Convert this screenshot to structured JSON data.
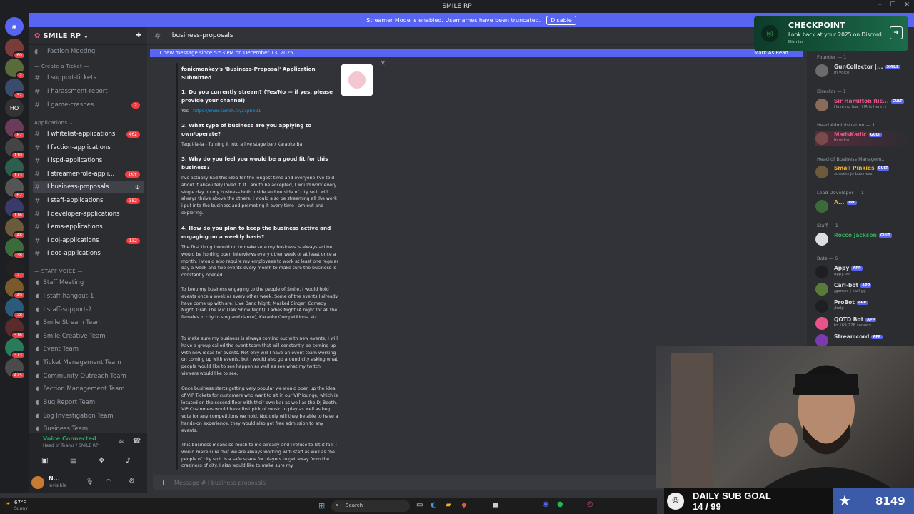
{
  "window": {
    "title": "SMILE RP"
  },
  "streamer_banner": {
    "text": "Streamer Mode is enabled. Usernames have been truncated.",
    "button": "Disable"
  },
  "server": {
    "name": "SMILE RP"
  },
  "guild_badges": [
    "60",
    "2",
    "32",
    "82",
    "110",
    "173",
    "62",
    "116",
    "48",
    "38",
    "27",
    "49",
    "28",
    "316",
    "373",
    "425"
  ],
  "channels": {
    "faction_meeting": "Faction Meeting",
    "create_ticket_cat": "Create a Ticket",
    "support_tickets": "I support-tickets",
    "harassment_report": "I harassment-report",
    "game_crashes": "I game-crashes",
    "game_crashes_count": "2",
    "applications_cat": "Applications",
    "whitelist_applications": "I whitelist-applications",
    "whitelist_count": "462",
    "faction_applications": "I faction-applications",
    "lspd_applications": "I lspd-applications",
    "streamer_role": "I streamer-role-appli...",
    "streamer_count": "1K+",
    "business_proposals": "I business-proposals",
    "staff_applications": "I staff-applications",
    "staff_count": "382",
    "developer_applications": "I developer-applications",
    "ems_applications": "I ems-applications",
    "doj_applications": "I doj-applications",
    "doj_count": "132",
    "doc_applications": "I doc-applications",
    "staff_voice_cat": "STAFF VOICE",
    "voice": [
      "Staff Meeting",
      "I staff-hangout-1",
      "I staff-support-2",
      "Smile Stream Team",
      "Smile Creative Team",
      "Event Team",
      "Ticket Management Team",
      "Community Outreach Team",
      "Faction Management Team",
      "Bug Report Team",
      "Log Investigation Team",
      "Business Team"
    ]
  },
  "voicebar": {
    "status": "Voice Connected",
    "location": "Head of Teams / SMILE RP"
  },
  "user": {
    "name": "N...",
    "status": "Invisible"
  },
  "header": {
    "channel": "I business-proposals"
  },
  "new_message": {
    "text": "1 new message since 5:53 PM on December 13, 2025",
    "mark": "Mark As Read"
  },
  "message": {
    "title": "fonicmonkey's 'Business-Proposal' Application Submitted",
    "q1": "1. Do you currently stream? (Yes/No — if yes, please provide your channel)",
    "a1_prefix": "Yes - ",
    "a1_link": "https://www.twitch.tv/21phe21",
    "q2": "2. What type of business are you applying to own/operate?",
    "a2": "Tequi-la-la - Turning it into a live stage bar/ Karaoke Bar",
    "q3": "3. Why do you feel you would be a good fit for this business?",
    "a3": "I've actually had this idea for the longest time and everyone I've told about it absolutely loved it. If I am to be accepted, I would work every single day on my business both inside and outside of city so it will always thrive above the others. I would also be streaming all the work i put into the business and promoting it every time i am out and exploring.",
    "q4": "4. How do you plan to keep the business active and engaging on a weekly basis?",
    "a4_p1": "The first thing I would do to make sure my business is always active would be holding open interviews every other week or at least once a month. I would also require my employees to work at least one regular day a week and two events every month to make sure the business is constantly opened.",
    "a4_p2": "To keep my business engaging to the people of Smile, I would hold events once a week or every other week. Some of the events I already have come up with are: Live Band Night, Masked Singer, Comedy Night, Grab The Mic (Talk Show Night), Ladies Night (A night for all the females in city to sing and dance), Karaoke Competitions, etc.",
    "a4_p3": "To make sure my business is always coming out with new events, I will have a group called the event team that will constantly be coming up with new ideas for events. Not only will I have an event team working on coming up with events, but i would also go around city asking what people would like to see happen as well as see what my twitch viewers would like to see.",
    "a4_p4": "Once business starts getting very popular we would open up the idea of VIP Tickets for customers who want to sit in our VIP lounge, which is located on the second floor with their own bar as well as the DJ Booth. VIP Customers would have first pick of music to play as well as help vote for any competitions we hold. Not only will they be able to have a hands-on experience, they would also get free admission to any events.",
    "a4_p5": "This business means so much to me already and I refuse to let it fail. I would make sure that we are always working with staff as well as the people of city so it is a safe space for players to get away from the craziness of city. I also would like to make sure my"
  },
  "composer": {
    "placeholder": "Message # I business-proposals"
  },
  "checkpoint": {
    "title": "CHECKPOINT",
    "subtitle": "Look back at your 2025 on Discord",
    "dismiss": "Dismiss"
  },
  "members": [
    {
      "group": "Founder — 1",
      "name": "GunCollector |...",
      "tag": "SMILE",
      "sub": "In voice",
      "color": "#dbdee1"
    },
    {
      "group": "Director — 1",
      "name": "Sir Hamilton Ric...",
      "tag": "GULT",
      "sub": "Have no fear; HR is here :)",
      "color": "#e8548a"
    },
    {
      "group": "Head Administration — 1",
      "name": "MadsKadic",
      "tag": "GULT",
      "sub": "In voice",
      "color": "#e8548a"
    },
    {
      "group": "Head of Business Managem...",
      "name": "Small Pinkies",
      "tag": "GULT",
      "sub": "sunsets jo business",
      "color": "#f0b132"
    },
    {
      "group": "Lead Developer — 1",
      "name": "A...",
      "tag": "TWI",
      "sub": "",
      "color": "#f0b132"
    },
    {
      "group": "Staff — 1",
      "name": "Rocco Jackson",
      "tag": "GULT",
      "sub": "",
      "color": "#3ba55c"
    },
    {
      "group": "Bots — 6",
      "name": "Appy",
      "tag": "APP",
      "sub": "appy.bot",
      "color": "#dbdee1"
    },
    {
      "group": "",
      "name": "Carl-bot",
      "tag": "APP",
      "sub": "/games | carl.gg",
      "color": "#dbdee1"
    },
    {
      "group": "",
      "name": "ProBot",
      "tag": "APP",
      "sub": "/help",
      "color": "#dbdee1"
    },
    {
      "group": "",
      "name": "QOTD Bot",
      "tag": "APP",
      "sub": "to 169,226 servers",
      "color": "#dbdee1"
    },
    {
      "group": "",
      "name": "Streamcord",
      "tag": "APP",
      "sub": "",
      "color": "#dbdee1"
    }
  ],
  "subgoal": {
    "label": "DAILY SUB GOAL",
    "progress": "14 / 99",
    "count": "8149"
  },
  "taskbar": {
    "weather": "67°F",
    "weather_sub": "Sunny",
    "search": "Search"
  },
  "colors": {
    "accent": "#5865f2",
    "bg": "#313338",
    "sidebar": "#2b2d31",
    "danger": "#f23f43"
  }
}
